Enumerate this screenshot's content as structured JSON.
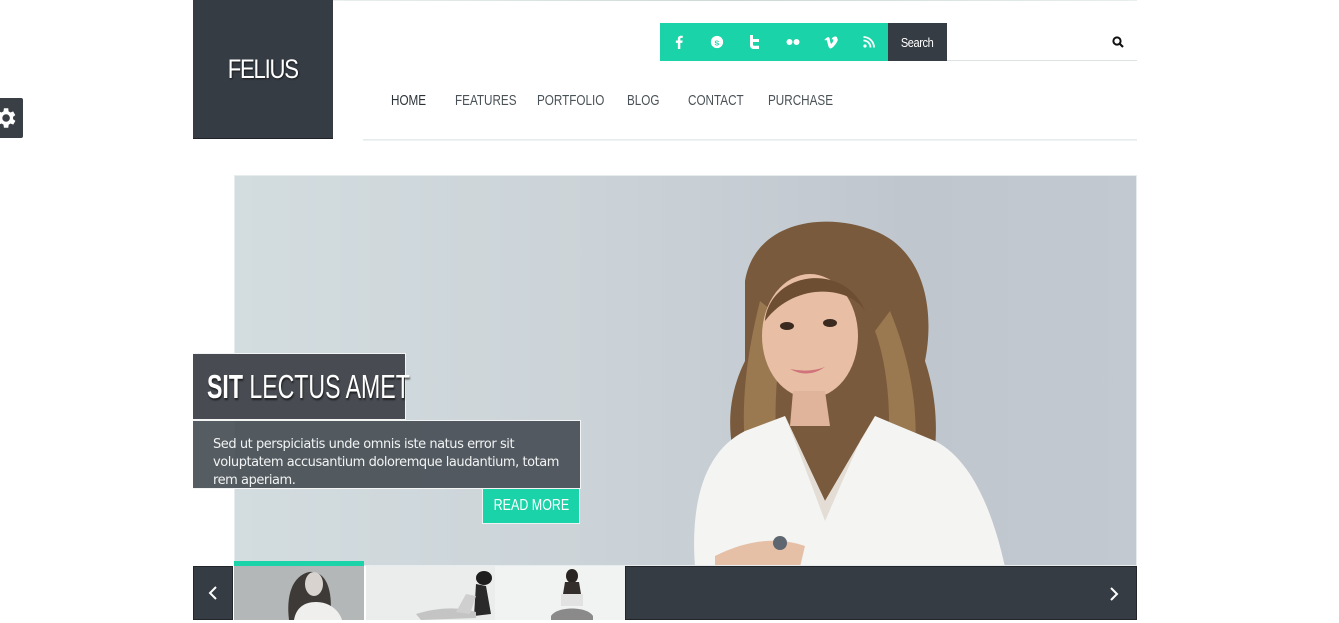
{
  "site": {
    "logo": "FELIUS",
    "brand_colors": {
      "accent": "#1ad3a8",
      "dark": "#363c44"
    }
  },
  "settings": {
    "icon": "gear-icon"
  },
  "social": [
    {
      "name": "facebook",
      "icon": "facebook-icon",
      "glyph": "f"
    },
    {
      "name": "skype",
      "icon": "skype-icon",
      "glyph": "S"
    },
    {
      "name": "twitter",
      "icon": "twitter-icon",
      "glyph": "t"
    },
    {
      "name": "flickr",
      "icon": "flickr-icon",
      "glyph": "••"
    },
    {
      "name": "vimeo",
      "icon": "vimeo-icon",
      "glyph": "v"
    },
    {
      "name": "rss",
      "icon": "rss-icon",
      "glyph": "rss"
    }
  ],
  "search": {
    "label": "Search",
    "value": "",
    "placeholder": "",
    "button_icon": "search-icon"
  },
  "nav": {
    "items": [
      {
        "label": "HOME",
        "active": true
      },
      {
        "label": "FEATURES",
        "active": false
      },
      {
        "label": "PORTFOLIO",
        "active": false
      },
      {
        "label": "BLOG",
        "active": false
      },
      {
        "label": "CONTACT",
        "active": false
      },
      {
        "label": "PURCHASE",
        "active": false
      }
    ]
  },
  "slider": {
    "caption": {
      "title_bold": "SIT",
      "title_rest": " LECTUS AMET",
      "description": "Sed ut perspiciatis unde omnis iste natus error sit voluptatem accusantium doloremque laudantium, totam rem aperiam.",
      "button": "READ MORE"
    },
    "thumbnails": [
      {
        "alt": "woman with curly hair",
        "active": true
      },
      {
        "alt": "woman sitting with hat",
        "active": false
      },
      {
        "alt": "woman with laptop",
        "active": false
      }
    ],
    "prev_icon": "chevron-left-icon",
    "next_icon": "chevron-right-icon"
  }
}
